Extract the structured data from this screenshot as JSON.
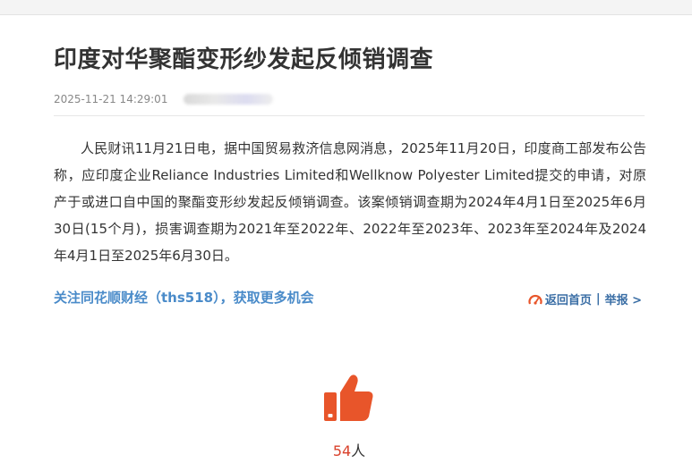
{
  "article": {
    "title": "印度对华聚酯变形纱发起反倾销调查",
    "datetime": "2025-11-21 14:29:01",
    "body": "人民财讯11月21日电，据中国贸易救济信息网消息，2025年11月20日，印度商工部发布公告称，应印度企业Reliance Industries Limited和Wellknow Polyester Limited提交的申请，对原产于或进口自中国的聚酯变形纱发起反倾销调查。该案倾销调查期为2024年4月1日至2025年6月30日(15个月)，损害调查期为2021年至2022年、2022年至2023年、2023年至2024年及2024年4月1日至2025年6月30日。"
  },
  "footer": {
    "follow_text": "关注同花顺财经（ths518），获取更多机会",
    "home_label": "返回首页",
    "separator": "|",
    "report_label": "举报 >"
  },
  "like": {
    "count": "54",
    "unit": "人"
  },
  "icons": {
    "home": "speedometer-icon",
    "like": "thumbs-up-icon"
  },
  "colors": {
    "accent_link": "#4a8bc9",
    "like_orange": "#e8552a",
    "count_red": "#d9412b"
  }
}
